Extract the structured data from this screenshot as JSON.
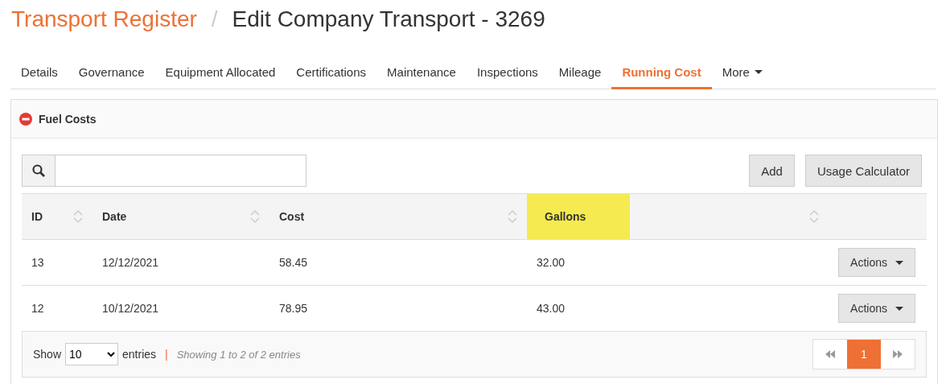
{
  "breadcrumb": {
    "parent": "Transport Register",
    "separator": "/",
    "title": "Edit Company Transport - 3269"
  },
  "tabs": [
    {
      "label": "Details",
      "selected": false
    },
    {
      "label": "Governance",
      "selected": false
    },
    {
      "label": "Equipment Allocated",
      "selected": false
    },
    {
      "label": "Certifications",
      "selected": false
    },
    {
      "label": "Maintenance",
      "selected": false
    },
    {
      "label": "Inspections",
      "selected": false
    },
    {
      "label": "Mileage",
      "selected": false
    },
    {
      "label": "Running Cost",
      "selected": true
    },
    {
      "label": "More",
      "selected": false,
      "kind": "dropdown"
    }
  ],
  "panel": {
    "title": "Fuel Costs",
    "expanded": true
  },
  "toolbar": {
    "buttons": [
      "Add",
      "Usage Calculator"
    ]
  },
  "table": {
    "columns": [
      {
        "label": "ID"
      },
      {
        "label": "Date"
      },
      {
        "label": "Cost"
      },
      {
        "label": "Gallons",
        "highlighted": true
      }
    ],
    "rows": [
      {
        "cells": [
          "13",
          "12/12/2021",
          "58.45",
          "32.00"
        ],
        "action": "Actions"
      },
      {
        "cells": [
          "12",
          "10/12/2021",
          "78.95",
          "43.00"
        ],
        "action": "Actions"
      }
    ]
  },
  "footer": {
    "show_label": "Show",
    "page_size": "10",
    "entries_label": "entries",
    "separator": "|",
    "info": "Showing 1 to 2 of 2 entries",
    "pages": [
      {
        "label": "1",
        "selected": true
      }
    ]
  }
}
